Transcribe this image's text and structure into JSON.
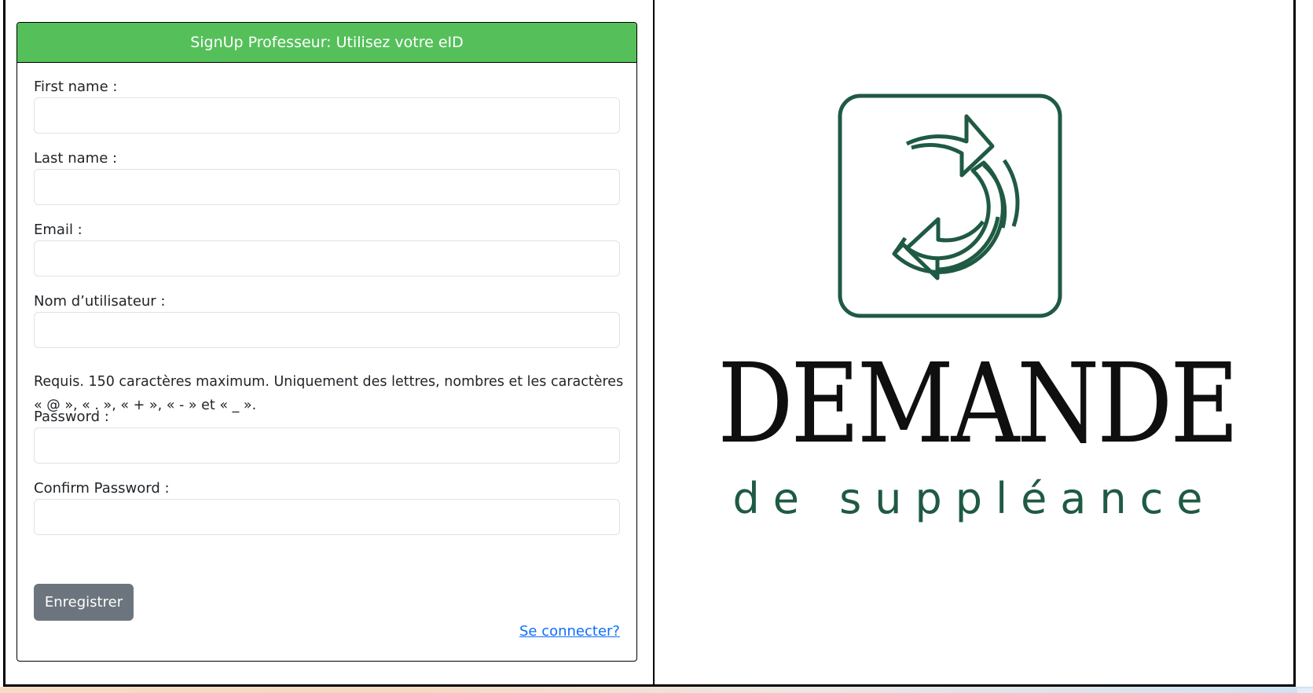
{
  "form": {
    "header": "SignUp Professeur: Utilisez votre eID",
    "fields": {
      "first_name": {
        "label": "First name :",
        "value": ""
      },
      "last_name": {
        "label": "Last name :",
        "value": ""
      },
      "email": {
        "label": "Email :",
        "value": ""
      },
      "username": {
        "label": "Nom d’utilisateur :",
        "value": ""
      },
      "password": {
        "label": "Password :",
        "value": ""
      },
      "confirm_password": {
        "label": "Confirm Password :",
        "value": ""
      }
    },
    "username_help": "Requis. 150 caractères maximum. Uniquement des lettres, nombres et les caractères « @ », « . », « + », « - » et « _ ».",
    "submit_label": "Enregistrer",
    "login_link": "Se connecter?"
  },
  "logo": {
    "title": "DEMANDE",
    "subtitle": "de suppléance",
    "icon": "refresh-cycle-icon",
    "color": "#1f5a43"
  },
  "colors": {
    "header_green": "#55c05a",
    "button_gray": "#6c757d",
    "link_blue": "#0d6efd"
  }
}
